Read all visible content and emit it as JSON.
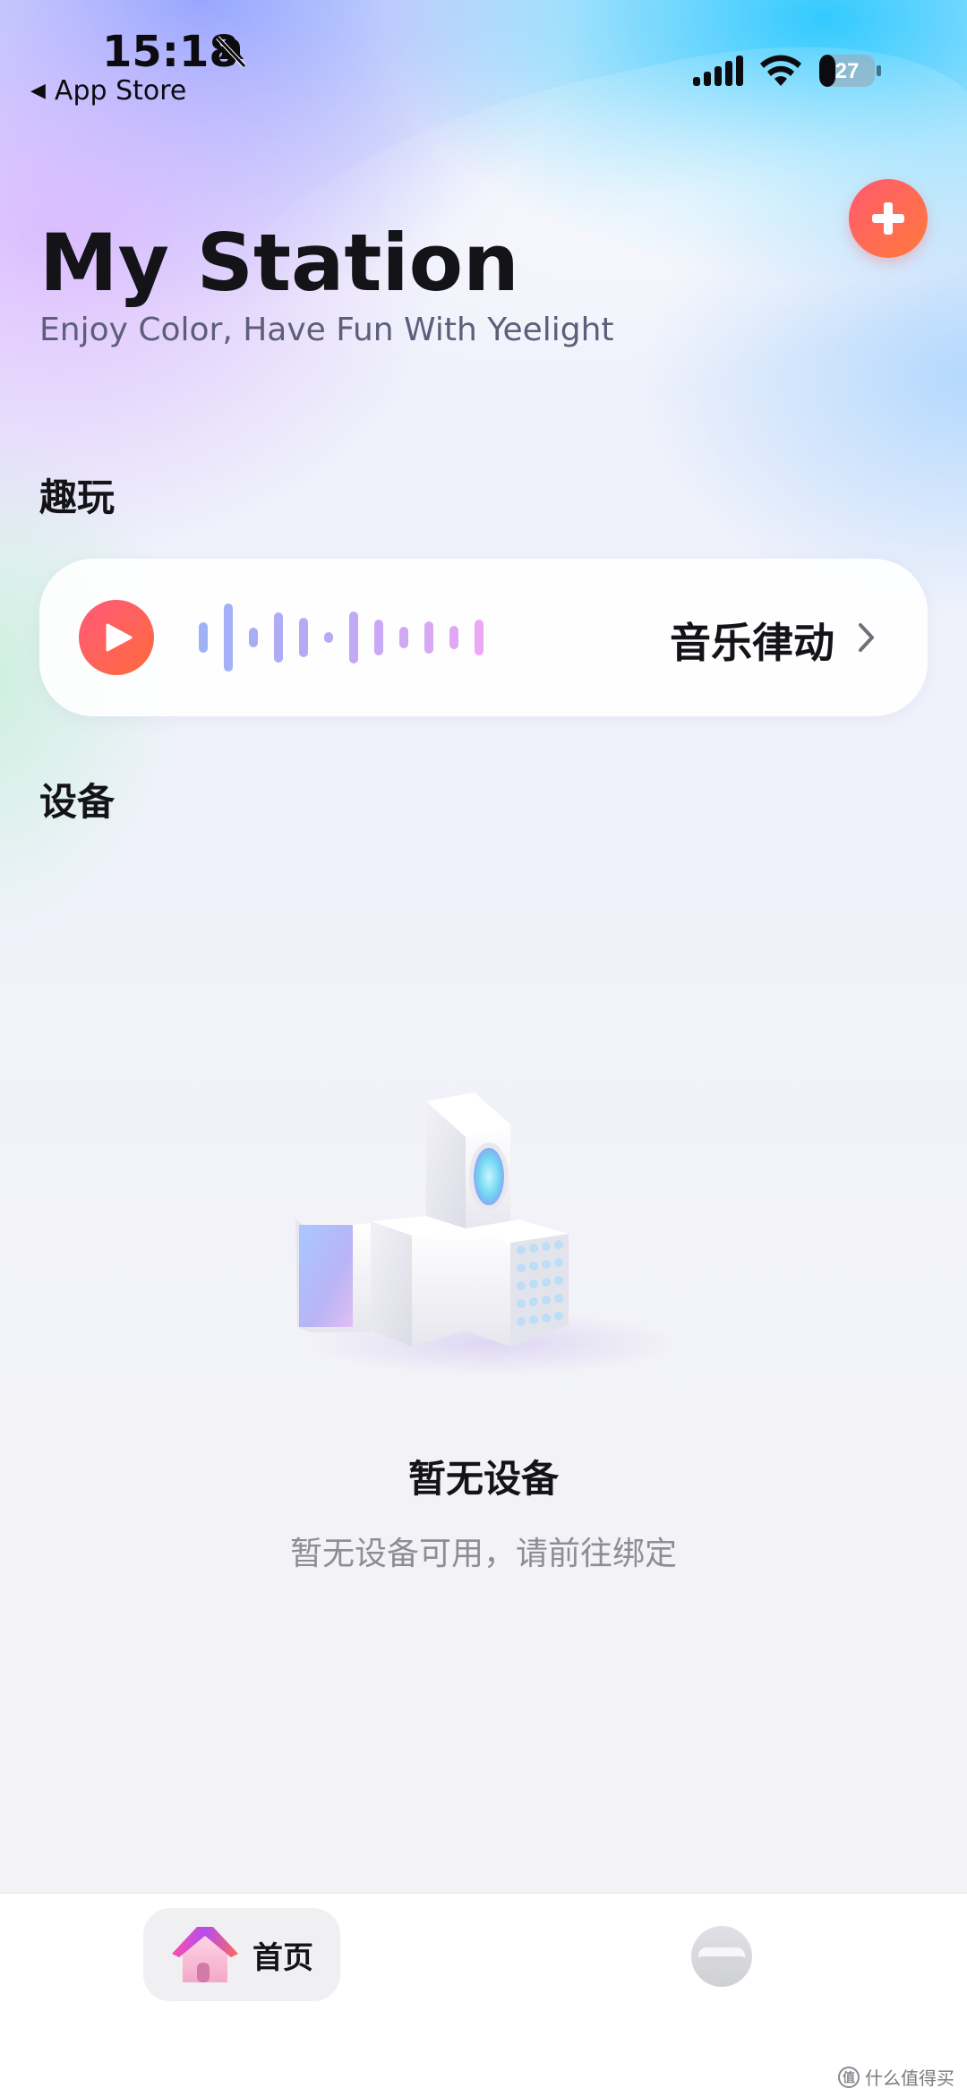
{
  "status_bar": {
    "time": "15:18",
    "back_app": "App Store",
    "battery": "27"
  },
  "header": {
    "title": "My Station",
    "subtitle": "Enjoy Color, Have Fun With Yeelight"
  },
  "sections": {
    "fun": "趣玩",
    "devices": "设备"
  },
  "music_card": {
    "label": "音乐律动"
  },
  "empty_state": {
    "title": "暂无设备",
    "description": "暂无设备可用，请前往绑定"
  },
  "tab_bar": {
    "home_label": "首页"
  },
  "watermark": {
    "logo": "值",
    "text": "什么值得买"
  },
  "colors": {
    "accent_red": "#ff5a6e",
    "accent_orange": "#ff7a3c",
    "wave_start": "#9fb0f5",
    "wave_end": "#f1a8f3"
  }
}
